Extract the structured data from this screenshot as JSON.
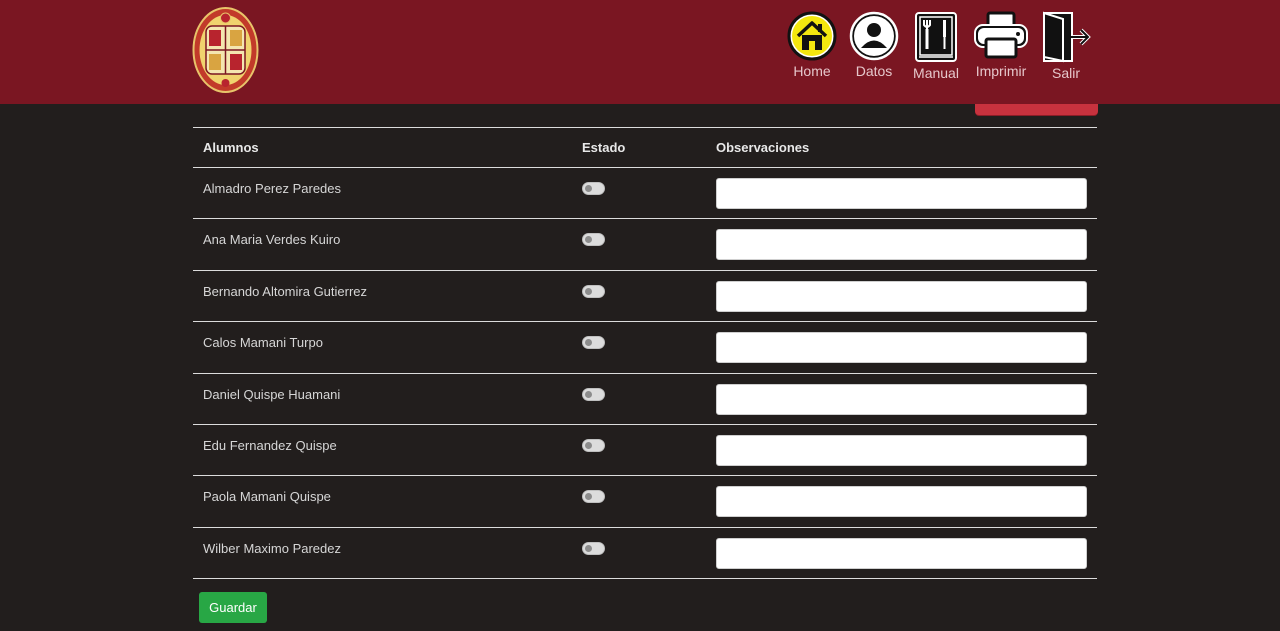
{
  "nav": {
    "home": "Home",
    "datos": "Datos",
    "manual": "Manual",
    "imprimir": "Imprimir",
    "salir": "Salir"
  },
  "table": {
    "headers": {
      "alumnos": "Alumnos",
      "estado": "Estado",
      "observaciones": "Observaciones"
    },
    "rows": [
      {
        "name": "Almadro Perez Paredes",
        "estado": false,
        "obs": ""
      },
      {
        "name": "Ana Maria Verdes Kuiro",
        "estado": false,
        "obs": ""
      },
      {
        "name": "Bernando Altomira Gutierrez",
        "estado": false,
        "obs": ""
      },
      {
        "name": "Calos Mamani Turpo",
        "estado": false,
        "obs": ""
      },
      {
        "name": "Daniel Quispe Huamani",
        "estado": false,
        "obs": ""
      },
      {
        "name": "Edu Fernandez Quispe",
        "estado": false,
        "obs": ""
      },
      {
        "name": "Paola Mamani Quispe",
        "estado": false,
        "obs": ""
      },
      {
        "name": "Wilber Maximo Paredez",
        "estado": false,
        "obs": ""
      }
    ]
  },
  "actions": {
    "save_label": "Guardar"
  },
  "colors": {
    "header_bg": "#7a1622",
    "page_bg": "#221e1d",
    "save_green": "#28a745",
    "accent_red": "#c8323e",
    "home_icon_yellow": "#f3e70f"
  },
  "icons": {
    "logo": "university-crest",
    "home": "home-icon",
    "datos": "user-icon",
    "manual": "tools-manual-icon",
    "imprimir": "printer-icon",
    "salir": "exit-door-icon"
  }
}
